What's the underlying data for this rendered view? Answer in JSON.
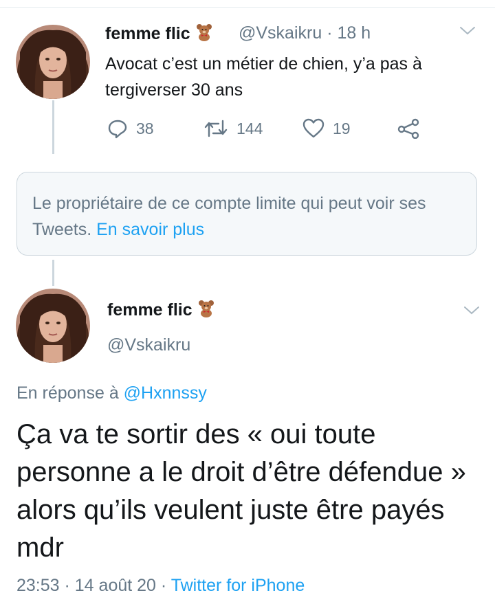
{
  "tweet1": {
    "display_name": "femme flic",
    "handle": "@Vskaikru",
    "sep": " · ",
    "time": "18 h",
    "text": "Avocat c’est un métier de chien, y’a pas à tergiverser 30 ans",
    "actions": {
      "reply_count": "38",
      "retweet_count": "144",
      "like_count": "19"
    }
  },
  "notice": {
    "text": "Le propriétaire de ce compte limite qui peut voir ses Tweets.",
    "link": "En savoir plus"
  },
  "tweet2": {
    "display_name": "femme flic",
    "handle": "@Vskaikru",
    "reply_prefix": "En réponse à",
    "reply_to": "@Hxnnssy",
    "text": "Ça va te sortir des « oui toute personne a le droit d’être défendue » alors qu’ils veulent juste être payés mdr",
    "time": "23:53",
    "sep": " · ",
    "date": "14 août 20",
    "source": "Twitter for iPhone"
  },
  "icons": {
    "badge": "teddy-bear-icon",
    "menu": "chevron-down-icon",
    "reply": "reply-icon",
    "retweet": "retweet-icon",
    "like": "heart-icon",
    "share": "share-icon"
  },
  "colors": {
    "link": "#1da1f2",
    "secondary_text": "#657786",
    "primary_text": "#14171a",
    "border": "#ccd6dd"
  }
}
